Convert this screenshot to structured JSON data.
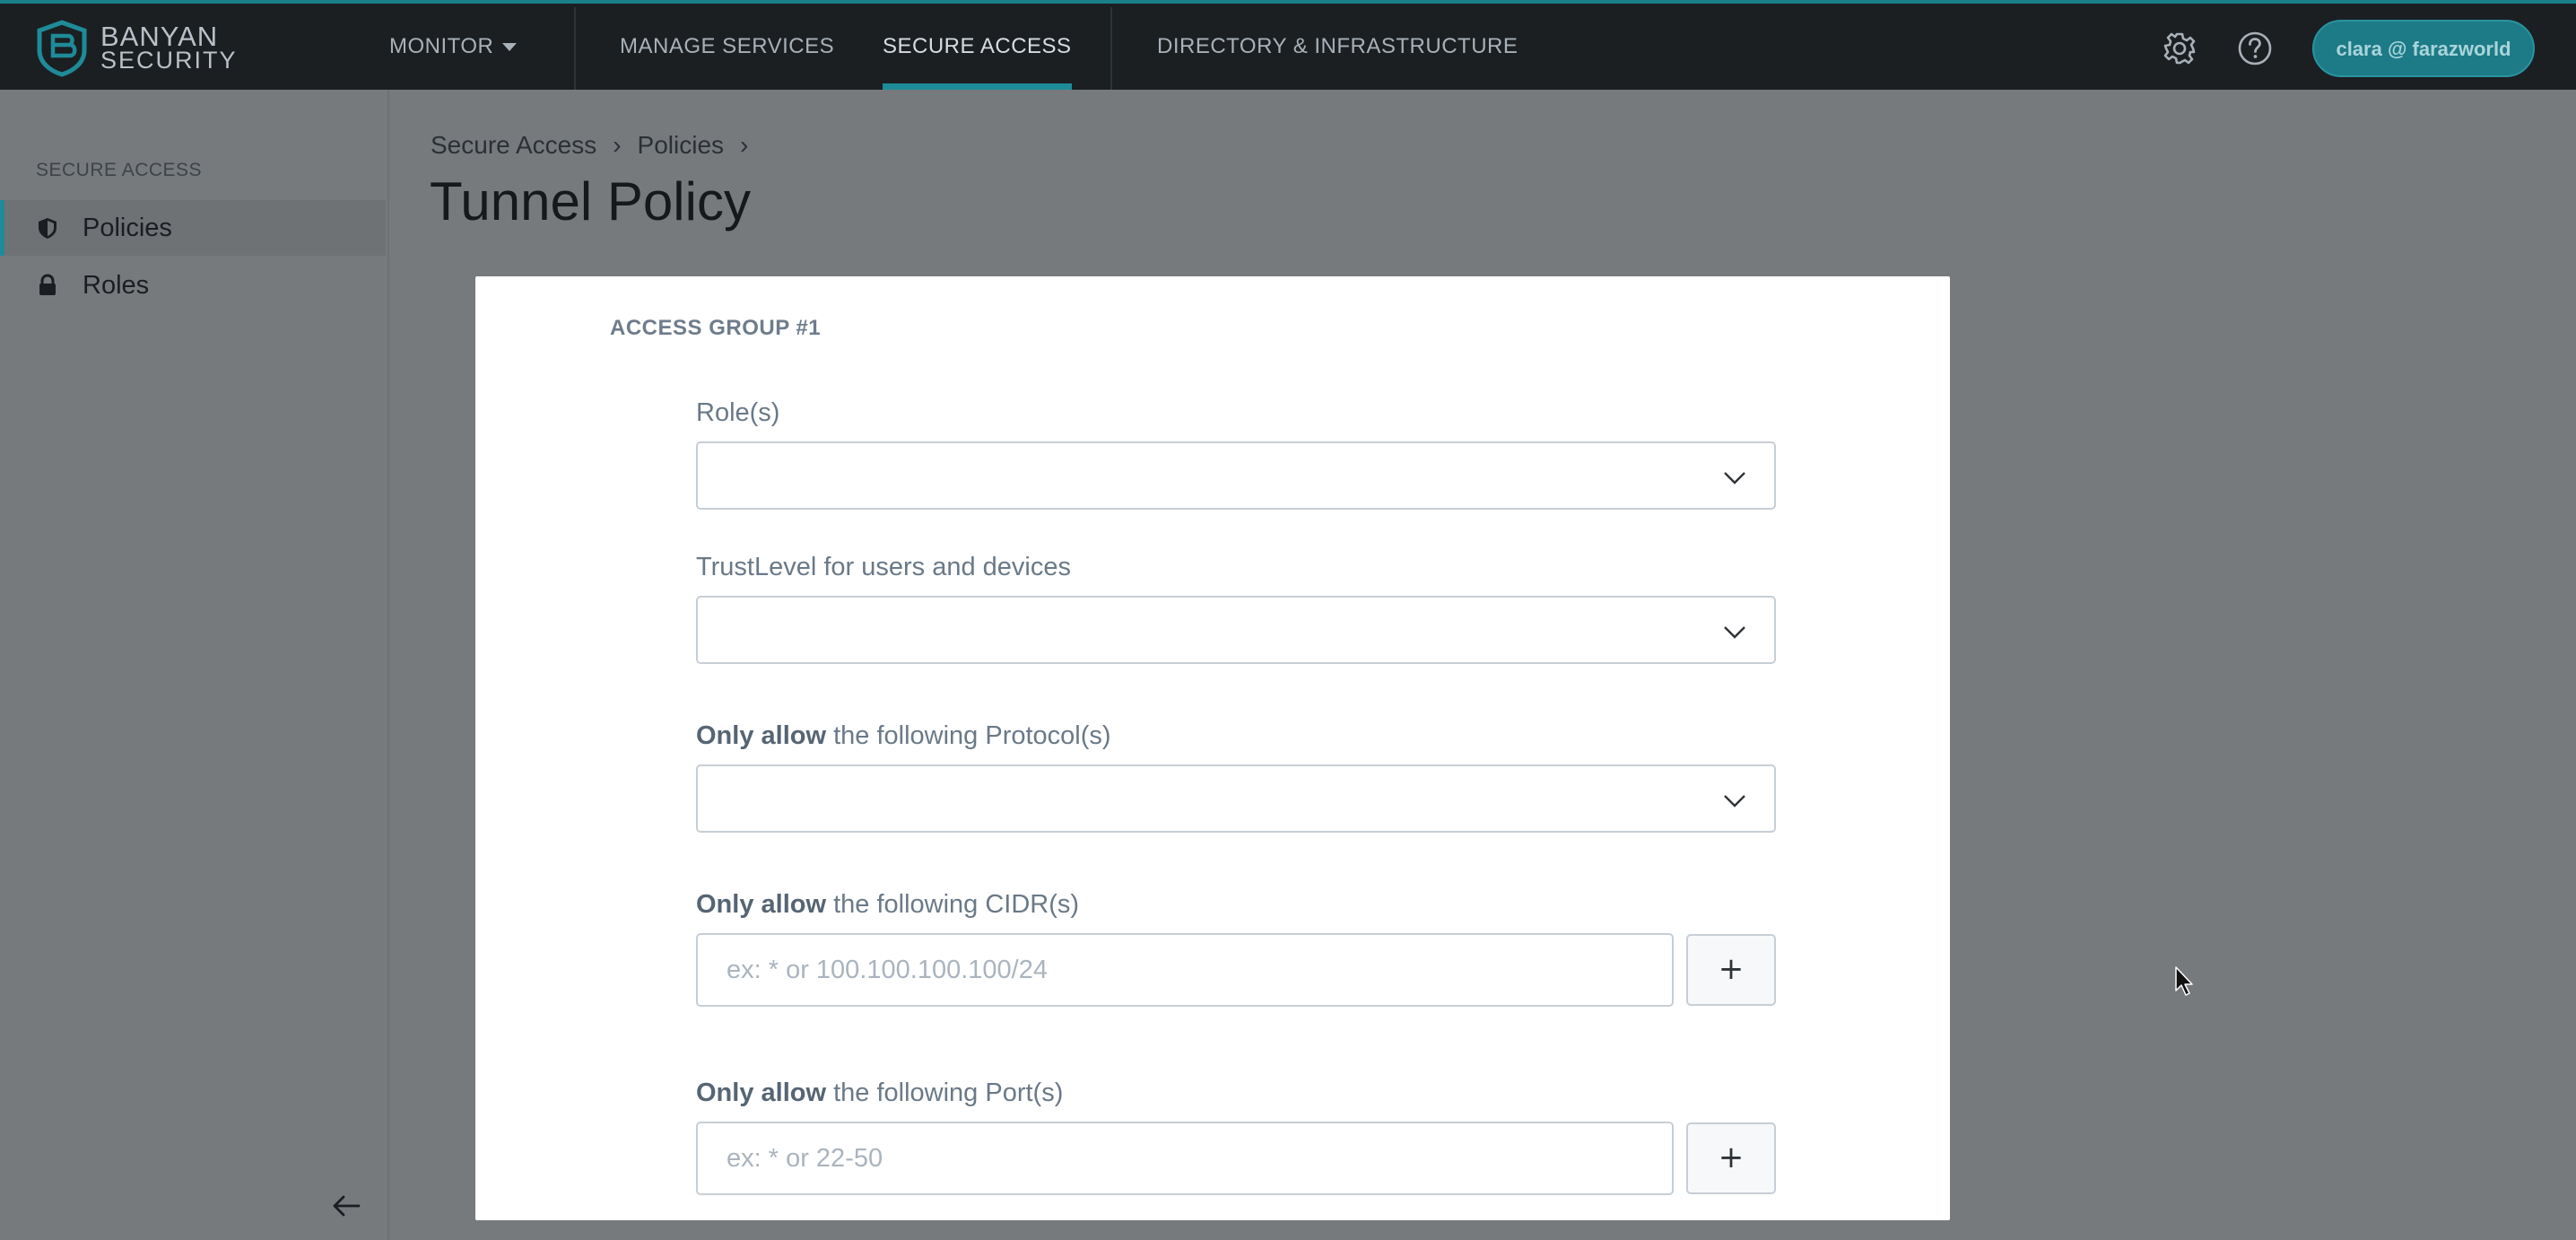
{
  "app": {
    "logo_line1": "BANYAN",
    "logo_line2": "SECURITY"
  },
  "topnav": {
    "items": [
      {
        "label": "MONITOR",
        "has_dropdown": true
      },
      {
        "label": "MANAGE SERVICES"
      },
      {
        "label": "SECURE ACCESS",
        "active": true
      },
      {
        "label": "DIRECTORY & INFRASTRUCTURE"
      }
    ],
    "user_label": "clara @ farazworld",
    "icons": [
      "gear-icon",
      "help-icon"
    ]
  },
  "sidebar": {
    "section_label": "SECURE ACCESS",
    "items": [
      {
        "label": "Policies",
        "icon": "shield-icon",
        "selected": true
      },
      {
        "label": "Roles",
        "icon": "lock-icon"
      }
    ],
    "collapse_icon": "arrow-left-icon"
  },
  "breadcrumb": [
    "Secure Access",
    "Policies"
  ],
  "page": {
    "title": "Tunnel Policy"
  },
  "form": {
    "group_title": "ACCESS GROUP #1",
    "roles_label": "Role(s)",
    "roles_value": "",
    "trust_label": "TrustLevel for users and devices",
    "trust_value": "",
    "protocols_label_bold": "Only allow",
    "protocols_label_rest": " the following Protocol(s)",
    "protocols_value": "",
    "cidr_label_bold": "Only allow",
    "cidr_label_rest": " the following CIDR(s)",
    "cidr_placeholder": "ex: * or 100.100.100.100/24",
    "cidr_value": "",
    "ports_label_bold": "Only allow",
    "ports_label_rest": " the following Port(s)",
    "ports_placeholder": "ex: * or 22-50",
    "ports_value": "",
    "add_label": "+"
  },
  "colors": {
    "accent": "#1e8b98",
    "topbar": "#1b1f22",
    "overlay": "#777a7d"
  }
}
